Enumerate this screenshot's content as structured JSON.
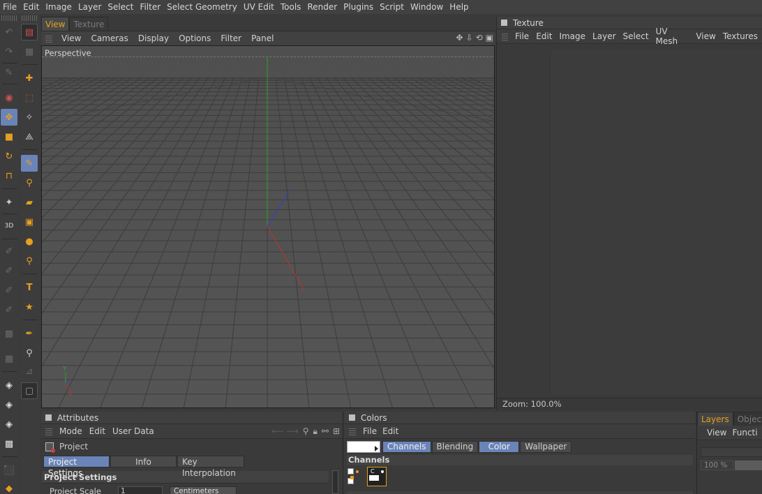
{
  "menubar": [
    "File",
    "Edit",
    "Image",
    "Layer",
    "Select",
    "Filter",
    "Select Geometry",
    "UV Edit",
    "Tools",
    "Render",
    "Plugins",
    "Script",
    "Window",
    "Help"
  ],
  "viewport": {
    "tabs": [
      "View",
      "Texture"
    ],
    "menu": [
      "View",
      "Cameras",
      "Display",
      "Options",
      "Filter",
      "Panel"
    ],
    "label": "Perspective",
    "gizmo": {
      "x": "X",
      "y": "Y"
    }
  },
  "texture_panel": {
    "title": "Texture",
    "menu": [
      "File",
      "Edit",
      "Image",
      "Layer",
      "Select",
      "UV Mesh",
      "View",
      "Textures"
    ],
    "zoom": "Zoom: 100.0%"
  },
  "attributes": {
    "title": "Attributes",
    "menu": [
      "Mode",
      "Edit",
      "User Data"
    ],
    "object": "Project",
    "tabs": [
      "Project Settings",
      "Info",
      "Key Interpolation"
    ],
    "section": "Project Settings",
    "field_label": "Project Scale",
    "field_value": "1",
    "field_unit": "Centimeters"
  },
  "colors": {
    "title": "Colors",
    "menu": [
      "File",
      "Edit"
    ],
    "tabs": [
      "Channels",
      "Blending",
      "Color",
      "Wallpaper"
    ],
    "channels_heading": "Channels",
    "swatch_color": "#ffffff"
  },
  "layers": {
    "tabs": [
      "Layers",
      "Objects"
    ],
    "menu": [
      "View",
      "Functi"
    ],
    "opacity": "100 %"
  },
  "colors_theme": {
    "accent": "#e6a020",
    "selection": "#6a84b8"
  }
}
